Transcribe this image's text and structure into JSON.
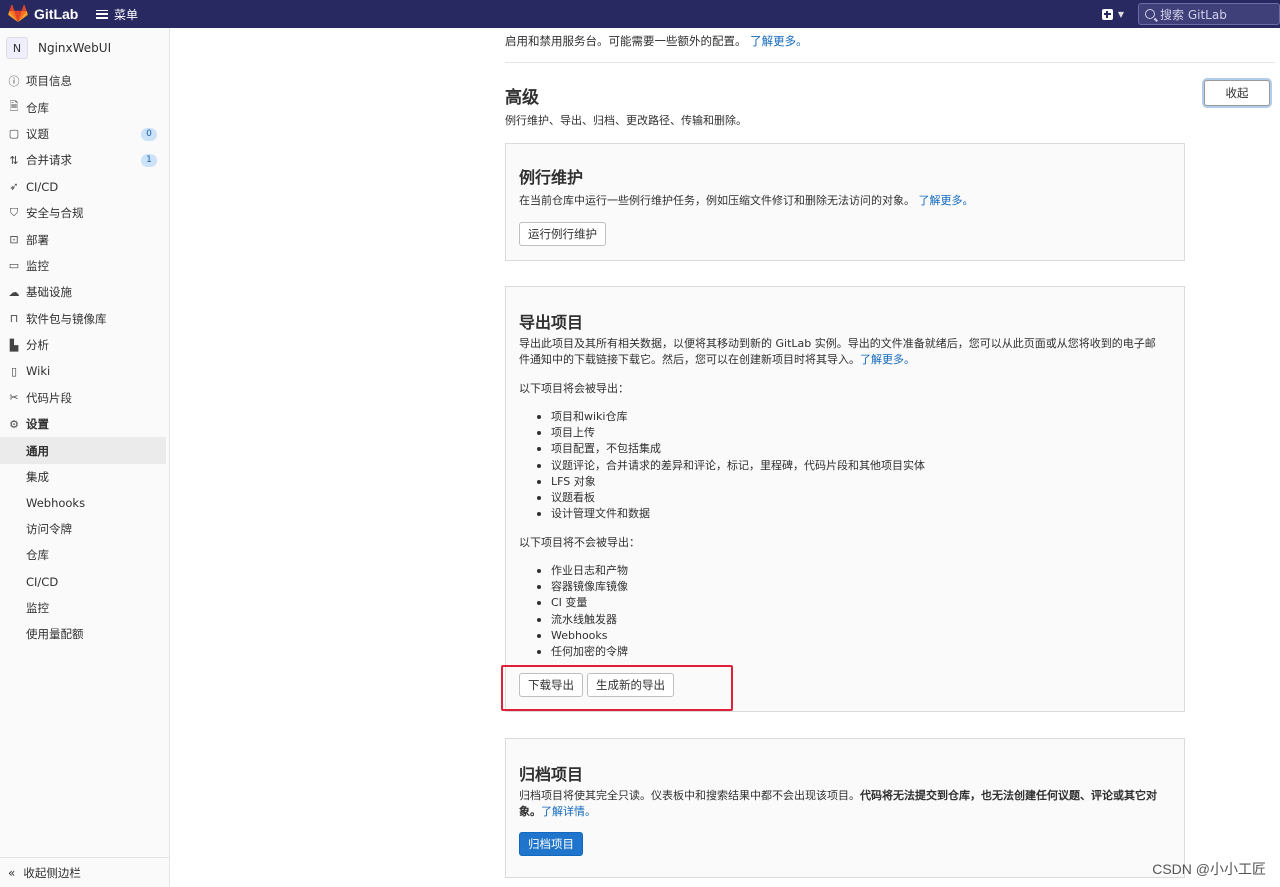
{
  "topbar": {
    "app_name": "GitLab",
    "menu_label": "菜单",
    "search_placeholder": "搜索 GitLab",
    "icons": [
      "gitlab-logo",
      "hamburger-icon",
      "plus-square-icon",
      "chevron-down-icon",
      "search-icon"
    ]
  },
  "sidebar": {
    "project_initial": "N",
    "project_name": "NginxWebUI",
    "items": [
      {
        "label": "项目信息",
        "icon": "info-icon"
      },
      {
        "label": "仓库",
        "icon": "doc-icon"
      },
      {
        "label": "议题",
        "icon": "issues-icon",
        "badge": "0"
      },
      {
        "label": "合并请求",
        "icon": "merge-icon",
        "badge": "1"
      },
      {
        "label": "CI/CD",
        "icon": "rocket-icon"
      },
      {
        "label": "安全与合规",
        "icon": "shield-icon"
      },
      {
        "label": "部署",
        "icon": "deploy-icon"
      },
      {
        "label": "监控",
        "icon": "monitor-icon"
      },
      {
        "label": "基础设施",
        "icon": "cloud-icon"
      },
      {
        "label": "软件包与镜像库",
        "icon": "package-icon"
      },
      {
        "label": "分析",
        "icon": "chart-icon"
      },
      {
        "label": "Wiki",
        "icon": "book-icon"
      },
      {
        "label": "代码片段",
        "icon": "scissors-icon"
      },
      {
        "label": "设置",
        "icon": "gear-icon"
      }
    ],
    "settings_sub": [
      "通用",
      "集成",
      "Webhooks",
      "访问令牌",
      "仓库",
      "CI/CD",
      "监控",
      "使用量配额"
    ],
    "collapse_label": "收起侧边栏"
  },
  "main": {
    "intro_text": "启用和禁用服务台。可能需要一些额外的配置。",
    "intro_link": "了解更多。",
    "advanced_title": "高级",
    "advanced_desc": "例行维护、导出、归档、更改路径、传输和删除。",
    "collapse_button": "收起",
    "housekeeping": {
      "title": "例行维护",
      "desc": "在当前仓库中运行一些例行维护任务，例如压缩文件修订和删除无法访问的对象。",
      "link": "了解更多。",
      "button": "运行例行维护"
    },
    "export": {
      "title": "导出项目",
      "desc_line1": "导出此项目及其所有相关数据，以便将其移动到新的 GitLab 实例。导出的文件准备就绪后，您可以从此页面或从您将收到的电子邮",
      "desc_line2": "件通知中的下载链接下载它。然后，您可以在创建新项目时将其导入。",
      "link": "了解更多。",
      "exported_heading": "以下项目将会被导出：",
      "exported_items": [
        "项目和wiki仓库",
        "项目上传",
        "项目配置，不包括集成",
        "议题评论，合并请求的差异和评论，标记，里程碑，代码片段和其他项目实体",
        "LFS 对象",
        "议题看板",
        "设计管理文件和数据"
      ],
      "not_exported_heading": "以下项目将不会被导出：",
      "not_exported_items": [
        "作业日志和产物",
        "容器镜像库镜像",
        "CI 变量",
        "流水线触发器",
        "Webhooks",
        "任何加密的令牌"
      ],
      "download_button": "下载导出",
      "generate_button": "生成新的导出"
    },
    "archive": {
      "title": "归档项目",
      "desc_plain": "归档项目将使其完全只读。仪表板中和搜索结果中都不会出现该项目。",
      "desc_bold_line1": "代码将无法提交到仓库，也无法创建任何议题、评论或其它对",
      "desc_bold_line2": "象。",
      "link": "了解详情。",
      "button": "归档项目"
    }
  },
  "watermark": "CSDN @小小工匠",
  "colors": {
    "topbar": "#292961",
    "accent": "#1f75cb",
    "highlight": "#e0203a"
  }
}
